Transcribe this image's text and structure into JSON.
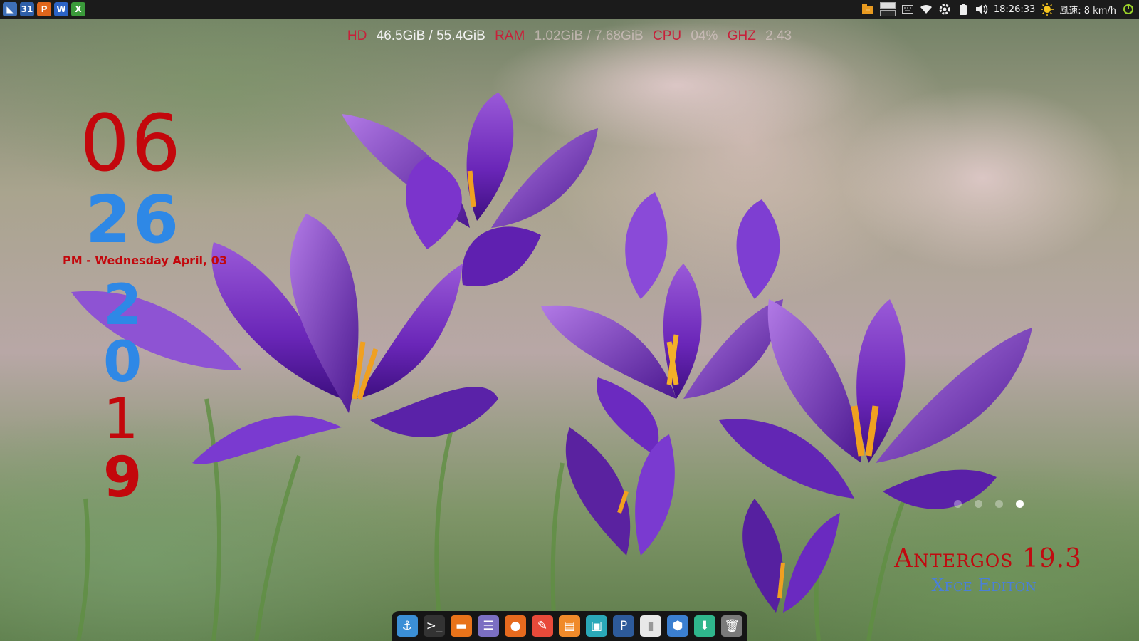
{
  "panel": {
    "launchers": [
      {
        "name": "antergos-menu",
        "glyph": "◣",
        "color": "#3e6fb8"
      },
      {
        "name": "calendar",
        "glyph": "31",
        "color": "#2f5fa8"
      },
      {
        "name": "wps-presentation",
        "glyph": "P",
        "color": "#e0661c"
      },
      {
        "name": "wps-writer",
        "glyph": "W",
        "color": "#2b63c6"
      },
      {
        "name": "wps-spreadsheets",
        "glyph": "X",
        "color": "#3a9a3a"
      }
    ],
    "clock": "18:26:33",
    "weather": "風速: 8 km/h"
  },
  "stats": {
    "hd_label": "HD",
    "hd_value": "46.5GiB / 55.4GiB",
    "ram_label": "RAM",
    "ram_value": "1.02GiB / 7.68GiB",
    "cpu_label": "CPU",
    "cpu_value": "04%",
    "ghz_label": "GHZ",
    "ghz_value": "2.43"
  },
  "clock_widget": {
    "hour": "06",
    "minute": "26",
    "date_line": "PM - Wednesday April, 03",
    "year_digits": [
      "2",
      "0",
      "1",
      "9"
    ]
  },
  "pager": {
    "count": 4,
    "active_index": 3
  },
  "branding": {
    "title": "Antergos 19.3",
    "subtitle": "Xfce Editon"
  },
  "dock": [
    {
      "name": "anchor",
      "glyph": "⚓",
      "color": "#3b8fd6"
    },
    {
      "name": "terminal",
      "glyph": ">_",
      "color": "#333"
    },
    {
      "name": "file-manager",
      "glyph": "▬",
      "color": "#e8731a"
    },
    {
      "name": "text-editor",
      "glyph": "☰",
      "color": "#7b6fc2"
    },
    {
      "name": "firefox",
      "glyph": "●",
      "color": "#e66a1e"
    },
    {
      "name": "task-manager",
      "glyph": "✎",
      "color": "#e84a3a"
    },
    {
      "name": "software-center",
      "glyph": "▤",
      "color": "#f08a2a"
    },
    {
      "name": "image-viewer",
      "glyph": "▣",
      "color": "#2aa8b8"
    },
    {
      "name": "pdf-reader",
      "glyph": "P",
      "color": "#2d5a9a"
    },
    {
      "name": "document",
      "glyph": "▮",
      "color": "#e8e8e8"
    },
    {
      "name": "package",
      "glyph": "⬢",
      "color": "#3b7fd0"
    },
    {
      "name": "updater",
      "glyph": "⬇",
      "color": "#2fb68c"
    },
    {
      "name": "trash",
      "glyph": "🗑",
      "color": "#7a7a7a"
    }
  ]
}
